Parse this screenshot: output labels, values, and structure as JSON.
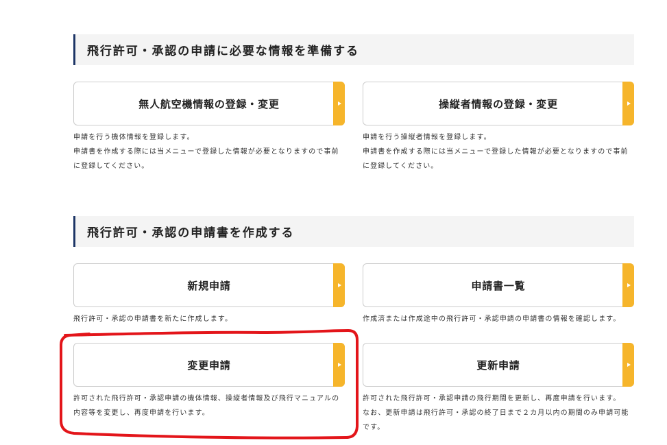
{
  "colors": {
    "accent": "#f6b52b",
    "header_border": "#1d3566",
    "header_bg": "#f4f4f4",
    "card_border": "#cccccc",
    "annotation": "#e3151a"
  },
  "icons": {
    "card_arrow": "triangle-right-icon"
  },
  "sections": [
    {
      "title": "飛行許可・承認の申請に必要な情報を準備する",
      "items": [
        {
          "label": "無人航空機情報の登録・変更",
          "description": [
            "申請を行う機体情報を登録します。",
            "申請書を作成する際には当メニューで登録した情報が必要となりますので事前",
            "に登録してください。"
          ]
        },
        {
          "label": "操縦者情報の登録・変更",
          "description": [
            "申請を行う操縦者情報を登録します。",
            "申請書を作成する際には当メニューで登録した情報が必要となりますので事前",
            "に登録してください。"
          ]
        }
      ]
    },
    {
      "title": "飛行許可・承認の申請書を作成する",
      "items": [
        {
          "label": "新規申請",
          "description": [
            "飛行許可・承認の申請書を新たに作成します。"
          ]
        },
        {
          "label": "申請書一覧",
          "description": [
            "作成済または作成途中の飛行許可・承認申請の申請書の情報を確認します。"
          ]
        },
        {
          "label": "変更申請",
          "description": [
            "許可された飛行許可・承認申請の機体情報、操縦者情報及び飛行マニュアルの",
            "内容等を変更し、再度申請を行います。"
          ]
        },
        {
          "label": "更新申請",
          "description": [
            "許可された飛行許可・承認申請の飛行期間を更新し、再度申請を行います。",
            "なお、更新申請は飛行許可・承認の終了日まで２カ月以内の期間のみ申請可能",
            "です。"
          ]
        }
      ]
    }
  ]
}
